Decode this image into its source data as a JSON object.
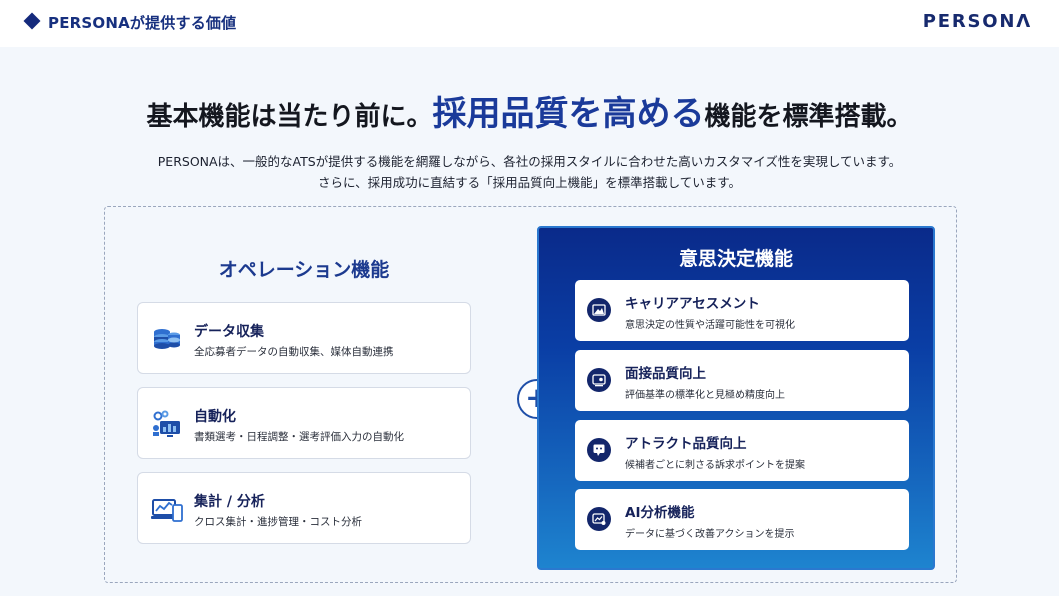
{
  "header": {
    "section_title": "PERSONAが提供する価値",
    "logo": "PERSONΛ"
  },
  "headline": {
    "part1": "基本機能は当たり前に。",
    "accent": "採用品質を高める",
    "part2": "機能を標準搭載。"
  },
  "subtitle": {
    "line1": "PERSONAは、一般的なATSが提供する機能を網羅しながら、各社の採用スタイルに合わせた高いカスタマイズ性を実現しています。",
    "line2": "さらに、採用成功に直結する「採用品質向上機能」を標準搭載しています。"
  },
  "operation": {
    "title": "オペレーション機能",
    "items": [
      {
        "title": "データ収集",
        "desc": "全応募者データの自動収集、媒体自動連携",
        "icon": "database-icon"
      },
      {
        "title": "自動化",
        "desc": "書類選考・日程調整・選考評価入力の自動化",
        "icon": "automation-icon"
      },
      {
        "title": "集計 / 分析",
        "desc": "クロス集計・進捗管理・コスト分析",
        "icon": "analytics-icon"
      }
    ]
  },
  "plus_symbol": "+",
  "decision": {
    "title": "意思決定機能",
    "items": [
      {
        "title": "キャリアアセスメント",
        "desc": "意思決定の性質や活躍可能性を可視化",
        "icon": "mountain-icon"
      },
      {
        "title": "面接品質向上",
        "desc": "評価基準の標準化と見極め精度向上",
        "icon": "interview-icon"
      },
      {
        "title": "アトラクト品質向上",
        "desc": "候補者ごとに刺さる訴求ポイントを提案",
        "icon": "chat-icon"
      },
      {
        "title": "AI分析機能",
        "desc": "データに基づく改善アクションを提示",
        "icon": "ai-icon"
      }
    ]
  },
  "colors": {
    "brand_navy": "#152a7c",
    "accent_blue": "#1a3a9a",
    "panel_gradient_top": "#0a2a8a",
    "panel_gradient_bottom": "#1e84cf"
  }
}
